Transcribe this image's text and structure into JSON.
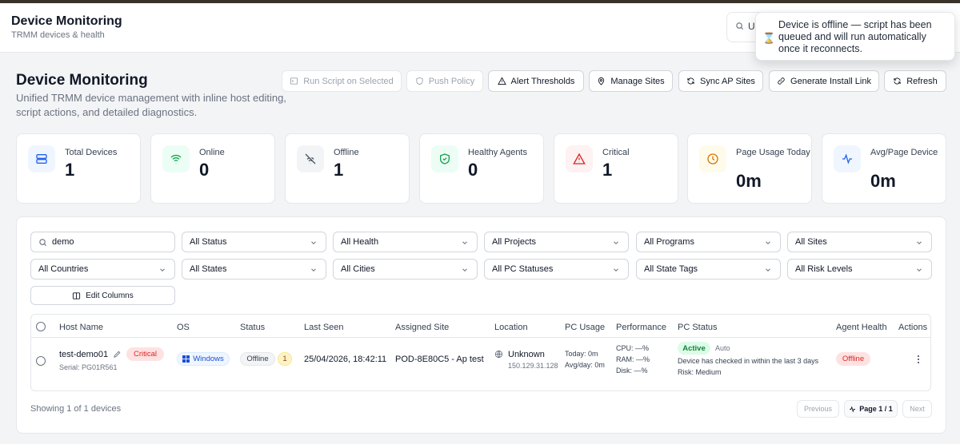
{
  "app": {
    "title": "Device Monitoring",
    "subtitle": "TRMM devices & health"
  },
  "top_search": {
    "value": "Ur"
  },
  "toast": {
    "message": "Device is offline — script has been queued and will run automatically once it reconnects."
  },
  "page": {
    "title": "Device Monitoring",
    "description": "Unified TRMM device management with inline host editing, script actions, and detailed diagnostics."
  },
  "toolbar": {
    "run_script": "Run Script on Selected",
    "push_policy": "Push Policy",
    "alert_thresholds": "Alert Thresholds",
    "manage_sites": "Manage Sites",
    "sync_ap_sites": "Sync AP Sites",
    "generate_install_link": "Generate Install Link",
    "refresh": "Refresh"
  },
  "stats": [
    {
      "label": "Total Devices",
      "value": "1",
      "color": "#2563eb",
      "bg": "#eff6ff",
      "icon": "server-icon"
    },
    {
      "label": "Online",
      "value": "0",
      "color": "#16a34a",
      "bg": "#ecfdf5",
      "icon": "wifi-icon"
    },
    {
      "label": "Offline",
      "value": "1",
      "color": "#4b5563",
      "bg": "#f3f4f6",
      "icon": "wifi-off-icon"
    },
    {
      "label": "Healthy Agents",
      "value": "0",
      "color": "#16a34a",
      "bg": "#ecfdf5",
      "icon": "shield-check-icon"
    },
    {
      "label": "Critical",
      "value": "1",
      "color": "#dc2626",
      "bg": "#fef2f2",
      "icon": "alert-triangle-icon"
    },
    {
      "label": "Page Usage Today",
      "value": "0m",
      "color": "#d97706",
      "bg": "#fffbeb",
      "icon": "clock-icon"
    },
    {
      "label": "Avg/Page Device",
      "value": "0m",
      "color": "#2563eb",
      "bg": "#eff6ff",
      "icon": "activity-icon"
    }
  ],
  "filters": {
    "search_value": "demo",
    "row1": [
      "All Status",
      "All Health",
      "All Projects",
      "All Programs",
      "All Sites"
    ],
    "row2": [
      "All Countries",
      "All States",
      "All Cities",
      "All PC Statuses",
      "All State Tags",
      "All Risk Levels"
    ],
    "edit_columns": "Edit Columns"
  },
  "table": {
    "headers": [
      "Host Name",
      "OS",
      "Status",
      "Last Seen",
      "Assigned Site",
      "Location",
      "PC Usage",
      "Performance",
      "PC Status",
      "Agent Health",
      "Actions"
    ],
    "row": {
      "host": "test-demo01",
      "critical_badge": "Critical",
      "serial": "Serial: PG01R561",
      "os": "Windows",
      "status": "Offline",
      "status_count": "1",
      "last_seen": "25/04/2026, 18:42:11",
      "site": "POD-8E80C5 - Ap test",
      "location": "Unknown",
      "ip": "150.129.31.128",
      "usage_today": "Today: 0m",
      "usage_avg": "Avg/day: 0m",
      "cpu": "CPU: —%",
      "ram": "RAM: —%",
      "disk": "Disk: —%",
      "pc_status": "Active",
      "pc_mode": "Auto",
      "pc_note": "Device has checked in within the last 3 days",
      "risk": "Risk: Medium",
      "agent_health": "Offline"
    }
  },
  "footer": {
    "showing": "Showing 1 of 1 devices",
    "previous": "Previous",
    "page": "Page 1 / 1",
    "next": "Next"
  }
}
